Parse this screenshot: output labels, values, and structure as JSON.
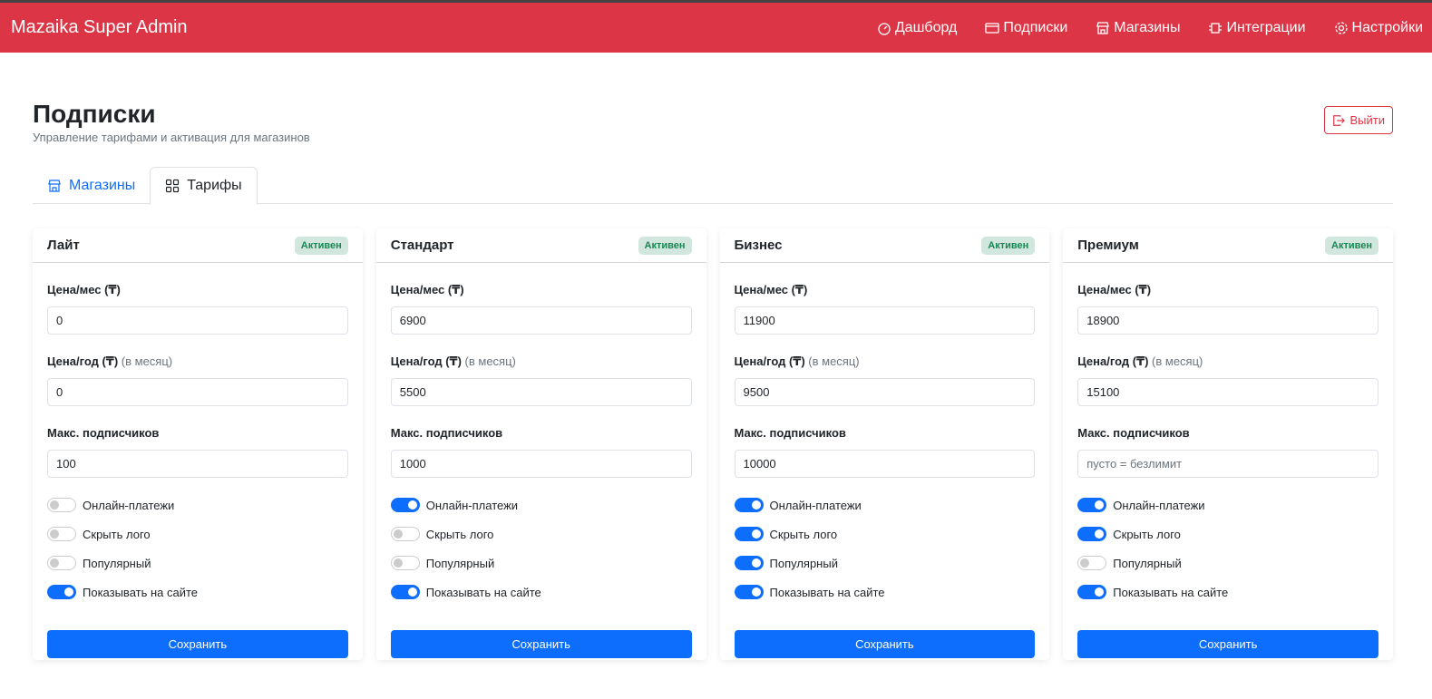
{
  "header": {
    "brand": "Mazaika Super Admin",
    "nav": [
      {
        "label": "Дашборд",
        "icon": "speedometer-icon"
      },
      {
        "label": "Подписки",
        "icon": "credit-card-icon"
      },
      {
        "label": "Магазины",
        "icon": "shop-icon"
      },
      {
        "label": "Интеграции",
        "icon": "plugin-icon"
      },
      {
        "label": "Настройки",
        "icon": "gear-icon"
      }
    ]
  },
  "page": {
    "title": "Подписки",
    "subtitle": "Управление тарифами и активация для магазинов",
    "logout": "Выйти"
  },
  "tabs": [
    {
      "label": "Магазины",
      "active": false
    },
    {
      "label": "Тарифы",
      "active": true
    }
  ],
  "labels": {
    "price_month": "Цена/мес (₸)",
    "price_year": "Цена/год (₸)",
    "price_year_note": "(в месяц)",
    "max_subs": "Макс. подписчиков",
    "online": "Онлайн-платежи",
    "hide_logo": "Скрыть лого",
    "popular": "Популярный",
    "show": "Показывать на сайте",
    "save": "Сохранить",
    "max_placeholder": "пусто = безлимит"
  },
  "plans": [
    {
      "name": "Лайт",
      "status": "Активен",
      "price_month": "0",
      "price_year": "0",
      "max_subs": "100",
      "online": false,
      "hide_logo": false,
      "popular": false,
      "show": true
    },
    {
      "name": "Стандарт",
      "status": "Активен",
      "price_month": "6900",
      "price_year": "5500",
      "max_subs": "1000",
      "online": true,
      "hide_logo": false,
      "popular": false,
      "show": true
    },
    {
      "name": "Бизнес",
      "status": "Активен",
      "price_month": "11900",
      "price_year": "9500",
      "max_subs": "10000",
      "online": true,
      "hide_logo": true,
      "popular": true,
      "show": true
    },
    {
      "name": "Премиум",
      "status": "Активен",
      "price_month": "18900",
      "price_year": "15100",
      "max_subs": "",
      "online": true,
      "hide_logo": true,
      "popular": false,
      "show": true
    }
  ],
  "colors": {
    "brand": "#dc3545",
    "primary": "#0d6efd",
    "success_bg": "#d1e7dd",
    "success": "#198754"
  }
}
